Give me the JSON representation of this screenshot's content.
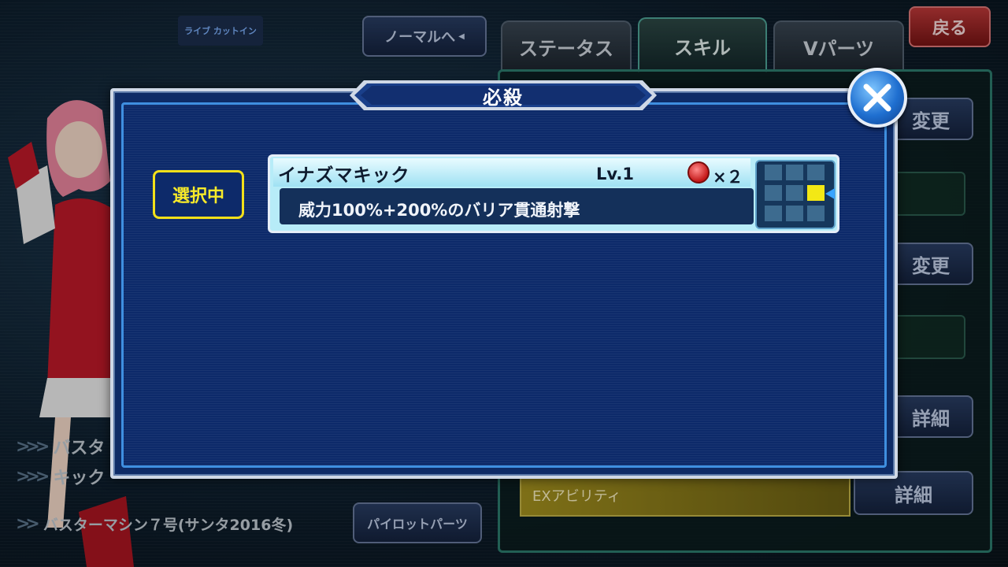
{
  "header": {
    "live_cutin_label": "ライブ カットイン",
    "normal_button_label": "ノーマルへ",
    "back_button_label": "戻る",
    "tabs": [
      {
        "label": "ステータス",
        "active": false
      },
      {
        "label": "スキル",
        "active": true
      },
      {
        "label": "Vパーツ",
        "active": false
      }
    ]
  },
  "right_panel": {
    "change_label_1": "変更",
    "change_label_2": "変更",
    "detail_label_1": "詳細",
    "detail_label_2": "詳細",
    "ex_ability_label": "EXアビリティ"
  },
  "left_panel": {
    "row1_label": "バスタ",
    "row2_label": "キック",
    "machine_label": "バスターマシン７号(サンタ2016冬)",
    "pilot_parts_button": "パイロットパーツ"
  },
  "dialog": {
    "title": "必殺",
    "selected_badge": "選択中",
    "skill": {
      "name": "イナズマキック",
      "level": "Lv.1",
      "cost": "×２",
      "description": "威力100%+200%のバリア貫通射撃",
      "grid_rows": 3,
      "grid_cols": 3,
      "active_cell": [
        1,
        2
      ]
    }
  },
  "colors": {
    "accent_yellow": "#f3e815",
    "dialog_blue": "#0d2a6a",
    "back_red": "#c33a3a"
  }
}
